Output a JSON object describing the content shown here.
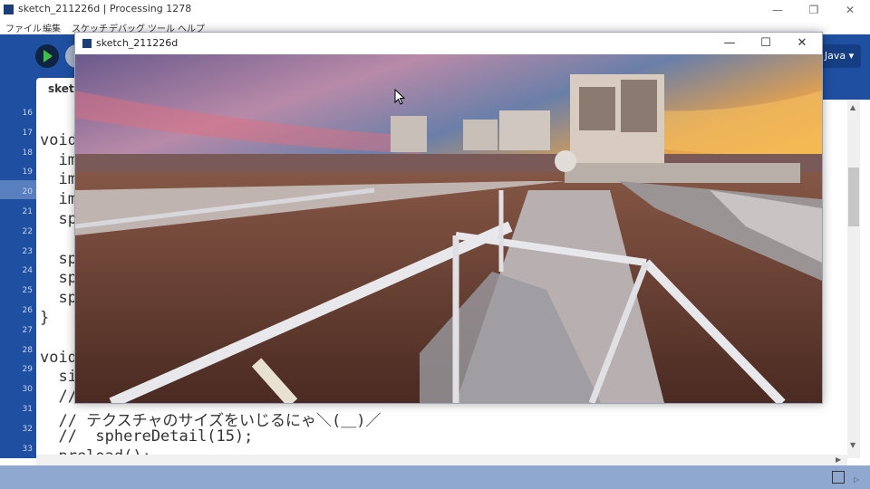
{
  "ide": {
    "title": "sketch_211226d | Processing 1278",
    "menu": [
      "ファイル",
      "編集",
      "スケッチ",
      "デバッグ",
      "ツール",
      "ヘルプ"
    ],
    "mode_label": "Java ▾",
    "tab_label": "sketc",
    "window_controls": [
      "—",
      "❐",
      "✕"
    ]
  },
  "editor": {
    "line_numbers": [
      "16",
      "17",
      "18",
      "19",
      "20",
      "21",
      "22",
      "23",
      "24",
      "25",
      "26",
      "27",
      "28",
      "29",
      "30",
      "31",
      "32",
      "33"
    ],
    "lines": [
      "",
      "void",
      "  im",
      "  im",
      "  im",
      "  sp",
      "",
      "  sp",
      "  sp",
      "  sp",
      "}",
      "",
      "void",
      "  si",
      "  //",
      "  // テクスチャのサイズをいじるにゃ＼(＿)／",
      "  //  sphereDetail(15);",
      "  preload();"
    ]
  },
  "sketch_window": {
    "title": "sketch_211226d",
    "controls": [
      "—",
      "☐",
      "✕"
    ]
  },
  "colors": {
    "toolbar": "#1e4fa0",
    "run_accent": "#3ec14a"
  },
  "icons": {
    "run": "play-icon",
    "stop": "stop-icon",
    "console": "console-icon",
    "cursor": "arrow-cursor-icon"
  }
}
